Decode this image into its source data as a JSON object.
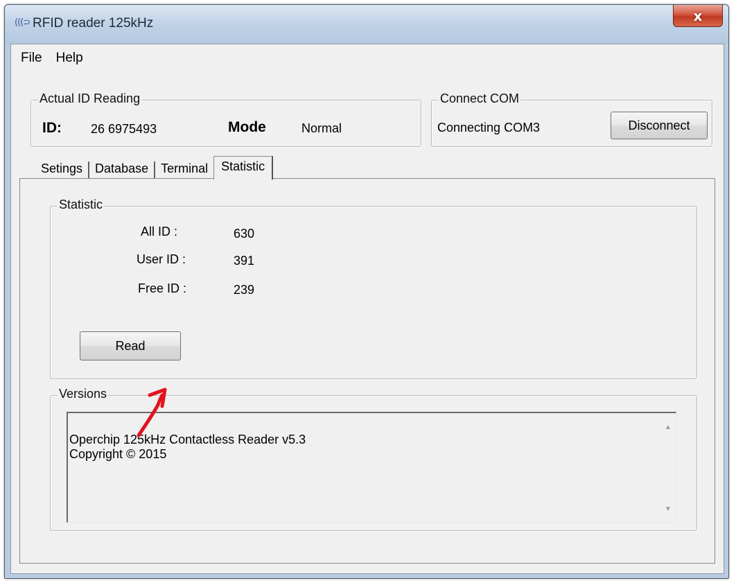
{
  "window": {
    "title": "RFID reader 125kHz",
    "close_glyph": "x",
    "icon": "rfid-icon"
  },
  "menu": {
    "items": [
      "File",
      "Help"
    ]
  },
  "actual_id": {
    "legend": "Actual ID Reading",
    "id_label": "ID:",
    "id_value": "26 6975493",
    "mode_label": "Mode",
    "mode_value": "Normal"
  },
  "connect": {
    "legend": "Connect COM",
    "status": "Connecting COM3",
    "button": "Disconnect"
  },
  "tabs": {
    "items": [
      "Setings",
      "Database",
      "Terminal",
      "Statistic"
    ],
    "active": "Statistic"
  },
  "statistic": {
    "legend": "Statistic",
    "all_label": "All ID :",
    "all_value": "630",
    "user_label": "User ID :",
    "user_value": "391",
    "free_label": "Free ID :",
    "free_value": "239",
    "read_button": "Read"
  },
  "versions": {
    "legend": "Versions",
    "line1": "Operchip 125kHz Contactless Reader v5.3",
    "line2": "Copyright © 2015"
  },
  "colors": {
    "annotation_arrow": "#e0141e",
    "close_button": "#c9452d"
  }
}
